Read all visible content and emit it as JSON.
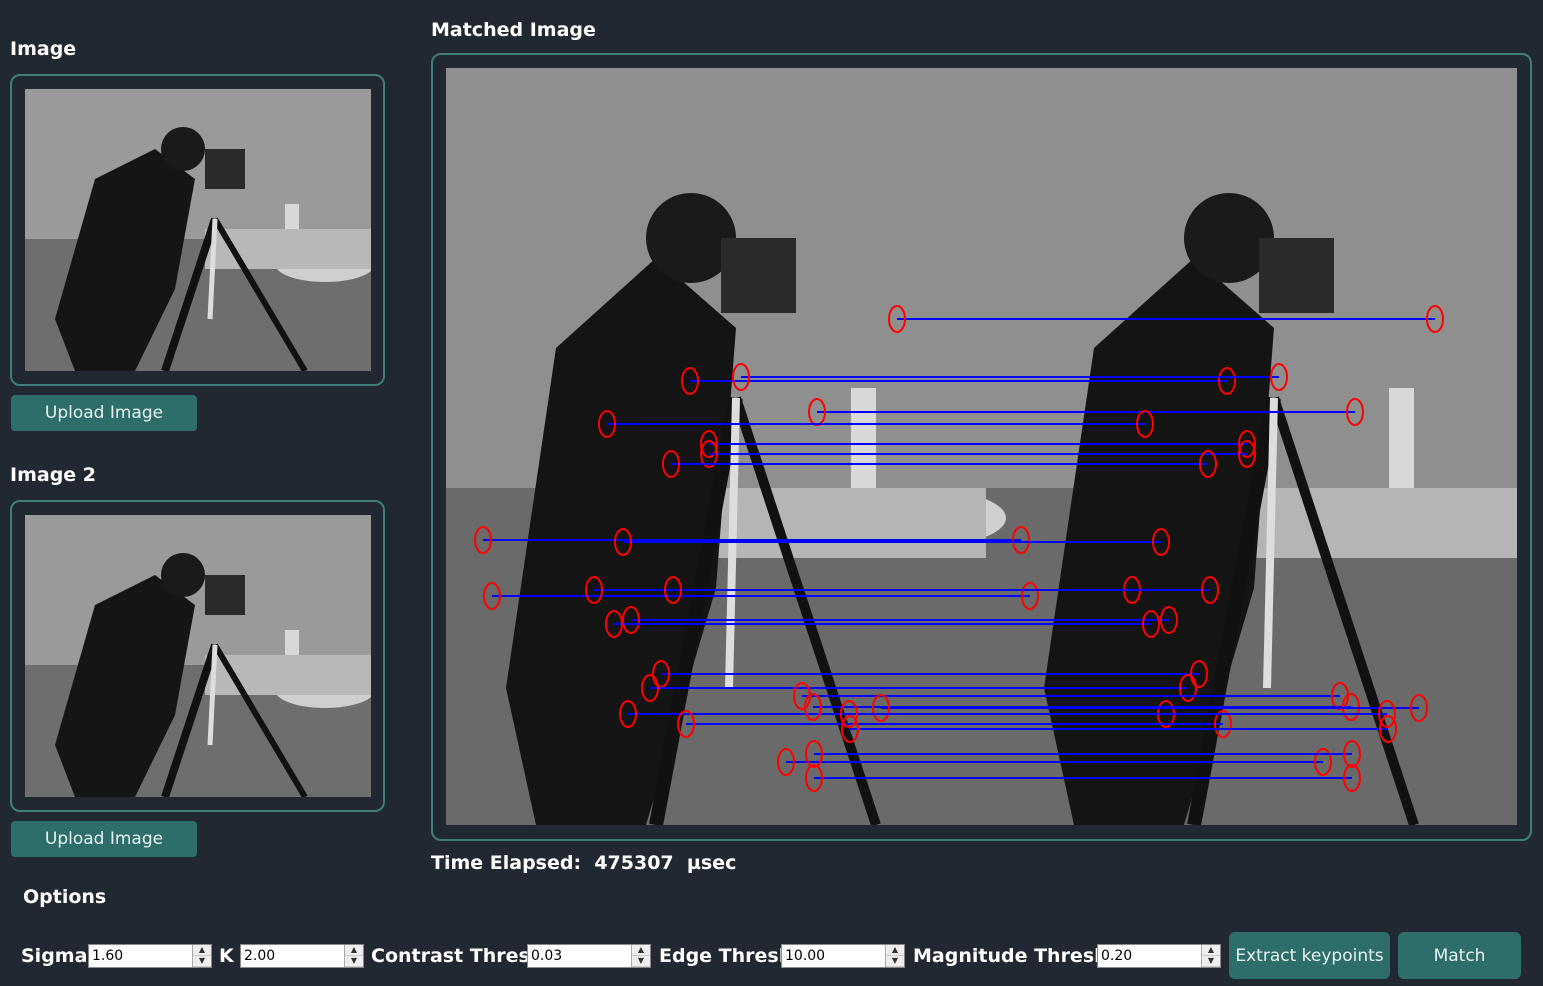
{
  "left": {
    "image1_heading": "Image",
    "image2_heading": "Image 2",
    "upload1_label": "Upload Image",
    "upload2_label": "Upload Image"
  },
  "matched": {
    "heading": "Matched Image",
    "time_label": "Time Elapsed:",
    "time_value": "475307",
    "time_unit": "µsec"
  },
  "options": {
    "heading": "Options",
    "sigma_label": "Sigma",
    "sigma_value": "1.60",
    "k_label": "K",
    "k_value": "2.00",
    "contrast_label": "Contrast Thresh",
    "contrast_value": "0.03",
    "edge_label": "Edge Thresh",
    "edge_value": "10.00",
    "magnitude_label": "Magnitude Thresh.",
    "magnitude_value": "0.20",
    "extract_label": "Extract keypoints",
    "match_label": "Match"
  },
  "colors": {
    "background": "#222831",
    "frame_border": "#3f7f7a",
    "button": "#2e6e6a",
    "keypoint": "#ff0000",
    "match_line": "#0000ff"
  }
}
